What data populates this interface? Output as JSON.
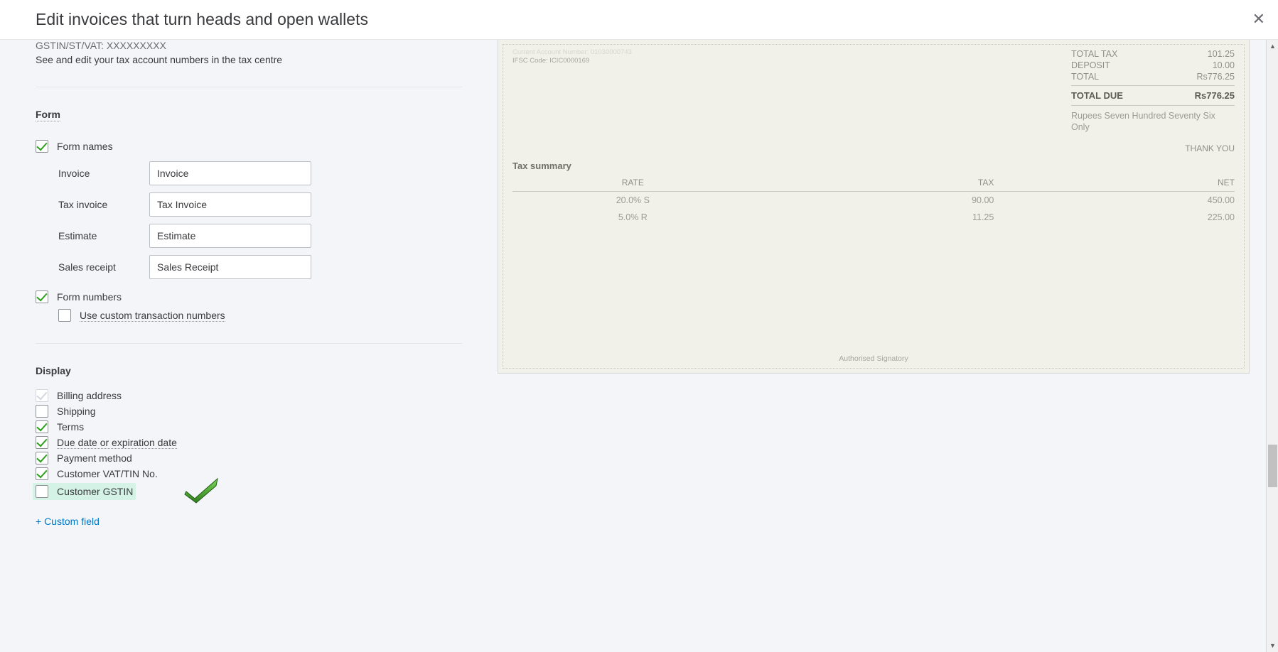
{
  "header": {
    "title": "Edit invoices that turn heads and open wallets"
  },
  "tax_hint": {
    "line1": "GSTIN/ST/VAT: XXXXXXXXX",
    "line2": "See and edit your tax account numbers in the tax centre"
  },
  "form_section": {
    "label": "Form",
    "form_names_label": "Form names",
    "fields": {
      "invoice_label": "Invoice",
      "invoice_value": "Invoice",
      "tax_invoice_label": "Tax invoice",
      "tax_invoice_value": "Tax Invoice",
      "estimate_label": "Estimate",
      "estimate_value": "Estimate",
      "sales_receipt_label": "Sales receipt",
      "sales_receipt_value": "Sales Receipt"
    },
    "form_numbers_label": "Form numbers",
    "custom_txn_label": "Use custom transaction numbers"
  },
  "display_section": {
    "label": "Display",
    "billing": "Billing address",
    "shipping": "Shipping",
    "terms": "Terms",
    "due_date": "Due date or expiration date",
    "payment_method": "Payment method",
    "vat_tin": "Customer VAT/TIN No.",
    "gstin": "Customer GSTIN",
    "custom_field": "+ Custom field"
  },
  "preview": {
    "acct_line": "Current Account Number: 01030000743",
    "ifsc_line": "IFSC Code: ICIC0000169",
    "totals": {
      "tax_label": "TOTAL TAX",
      "tax_val": "101.25",
      "deposit_label": "DEPOSIT",
      "deposit_val": "10.00",
      "total_label": "TOTAL",
      "total_val": "Rs776.25",
      "due_label": "TOTAL DUE",
      "due_val": "Rs776.25",
      "words": "Rupees Seven Hundred Seventy Six Only"
    },
    "thankyou": "THANK YOU",
    "tax_summary_label": "Tax summary",
    "tax_cols": {
      "rate": "RATE",
      "tax": "TAX",
      "net": "NET"
    },
    "tax_rows": [
      {
        "rate": "20.0% S",
        "tax": "90.00",
        "net": "450.00"
      },
      {
        "rate": "5.0% R",
        "tax": "11.25",
        "net": "225.00"
      }
    ],
    "auth_sig": "Authorised Signatory"
  }
}
